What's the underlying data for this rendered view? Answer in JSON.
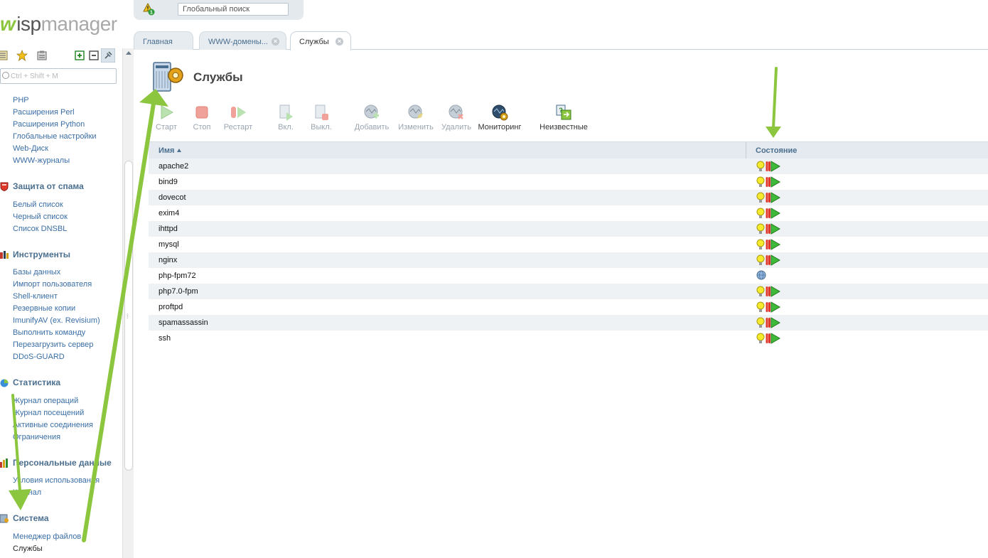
{
  "app": {
    "logo_mark": "w",
    "logo_isp": "isp",
    "logo_manager": "manager"
  },
  "sidebar": {
    "search_placeholder": "Ctrl + Shift + M",
    "items_top": [
      "PHP",
      "Расширения Perl",
      "Расширения Python",
      "Глобальные настройки",
      "Web-Диск",
      "WWW-журналы"
    ],
    "groups": [
      {
        "title": "Защита от спама",
        "items": [
          "Белый список",
          "Черный список",
          "Список DNSBL"
        ]
      },
      {
        "title": "Инструменты",
        "items": [
          "Базы данных",
          "Импорт пользователя",
          "Shell-клиент",
          "Резервные копии",
          "ImunifyAV (ex. Revisium)",
          "Выполнить команду",
          "Перезагрузить сервер",
          "DDoS-GUARD"
        ]
      },
      {
        "title": "Статистика",
        "items": [
          "Журнал операций",
          "Журнал посещений",
          "Активные соединения",
          "Ограничения"
        ]
      },
      {
        "title": "Персональные данные",
        "items": [
          "Условия использования",
          "Журнал"
        ]
      },
      {
        "title": "Система",
        "items": [
          "Менеджер файлов",
          "Службы"
        ]
      }
    ]
  },
  "topbar": {
    "warning_count": "1",
    "search_placeholder": "Глобальный поиск"
  },
  "tabs": [
    {
      "label": "Главная",
      "closable": false
    },
    {
      "label": "WWW-домены...",
      "closable": true
    },
    {
      "label": "Службы",
      "closable": true
    }
  ],
  "page": {
    "title": "Службы"
  },
  "toolbar": [
    {
      "label": "Старт",
      "enabled": false,
      "icon": "play-icon"
    },
    {
      "label": "Стоп",
      "enabled": false,
      "icon": "stop-icon"
    },
    {
      "label": "Рестарт",
      "enabled": false,
      "icon": "restart-icon"
    },
    {
      "label": "Вкл.",
      "enabled": false,
      "icon": "enable-icon"
    },
    {
      "label": "Выкл.",
      "enabled": false,
      "icon": "disable-icon"
    },
    {
      "label": "Добавить",
      "enabled": false,
      "icon": "add-monitor-icon"
    },
    {
      "label": "Изменить",
      "enabled": false,
      "icon": "edit-monitor-icon"
    },
    {
      "label": "Удалить",
      "enabled": false,
      "icon": "delete-monitor-icon"
    },
    {
      "label": "Мониторинг",
      "enabled": true,
      "icon": "monitoring-icon"
    },
    {
      "label": "Неизвестные",
      "enabled": true,
      "icon": "unknown-services-icon"
    }
  ],
  "table": {
    "columns": [
      "Имя",
      "Состояние"
    ],
    "sort_column": "Имя",
    "rows": [
      {
        "name": "apache2",
        "state": "running"
      },
      {
        "name": "bind9",
        "state": "running"
      },
      {
        "name": "dovecot",
        "state": "running"
      },
      {
        "name": "exim4",
        "state": "running"
      },
      {
        "name": "ihttpd",
        "state": "running"
      },
      {
        "name": "mysql",
        "state": "running"
      },
      {
        "name": "nginx",
        "state": "running"
      },
      {
        "name": "php-fpm72",
        "state": "unmonitored"
      },
      {
        "name": "php7.0-fpm",
        "state": "running"
      },
      {
        "name": "proftpd",
        "state": "running"
      },
      {
        "name": "spamassassin",
        "state": "running"
      },
      {
        "name": "ssh",
        "state": "running"
      }
    ]
  },
  "colors": {
    "accent": "#3a6ea5",
    "header": "#4b6f8f",
    "arrow": "#8cc63f"
  }
}
